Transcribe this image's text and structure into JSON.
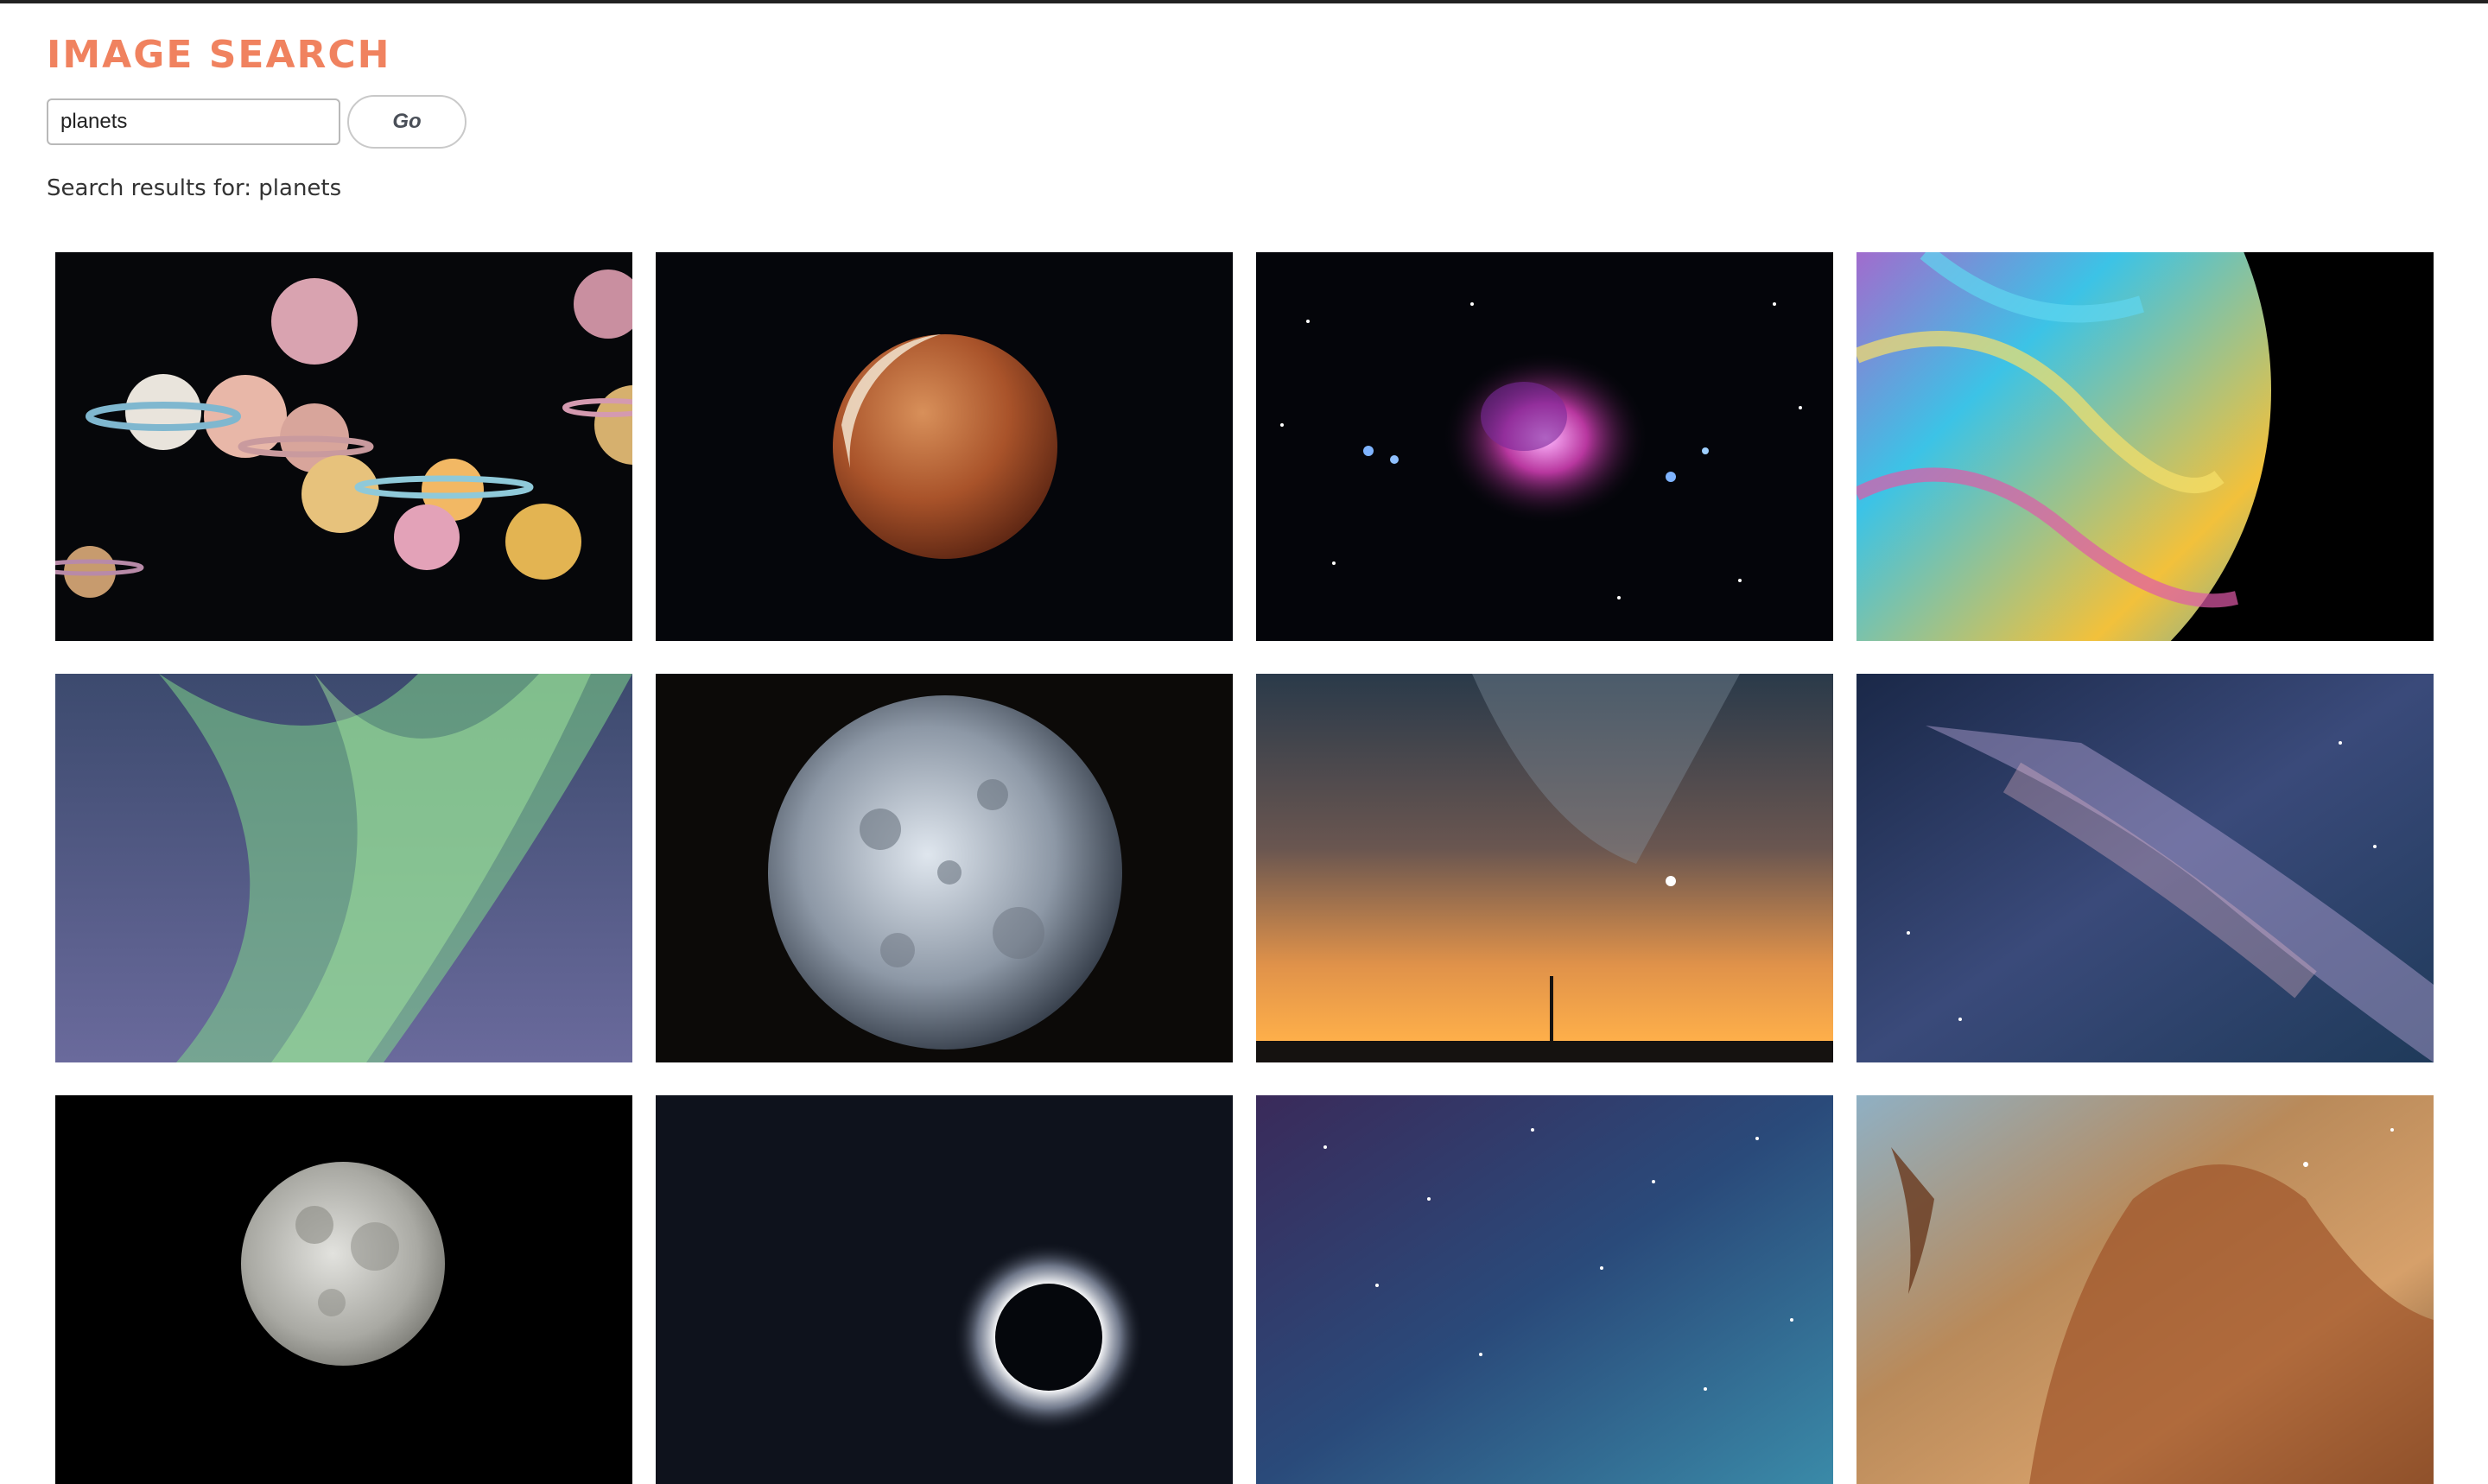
{
  "header": {
    "title": "IMAGE SEARCH",
    "title_color": "#f0825f"
  },
  "search": {
    "value": "planets",
    "button_label": "Go"
  },
  "results": {
    "caption_prefix": "Search results for:",
    "caption_query": "planets",
    "images": [
      {
        "subject": "toy-planets-with-rings"
      },
      {
        "subject": "blood-moon"
      },
      {
        "subject": "orion-nebula"
      },
      {
        "subject": "soap-bubble-planet"
      },
      {
        "subject": "aurora-borealis"
      },
      {
        "subject": "moon-sculpture"
      },
      {
        "subject": "milky-way-sunset-sky"
      },
      {
        "subject": "milky-way-galaxy"
      },
      {
        "subject": "full-moon"
      },
      {
        "subject": "solar-eclipse"
      },
      {
        "subject": "starry-night-sky"
      },
      {
        "subject": "carina-nebula"
      }
    ]
  }
}
